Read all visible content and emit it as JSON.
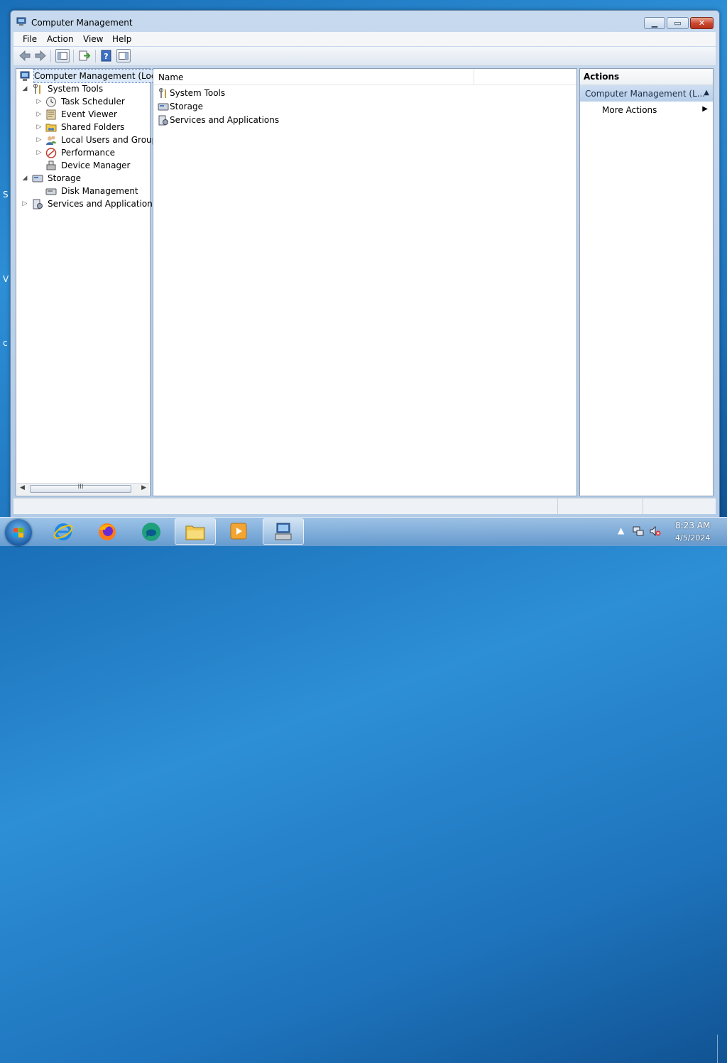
{
  "window": {
    "title": "Computer Management",
    "min_glyph": "▁",
    "max_glyph": "▭",
    "close_glyph": "✕"
  },
  "desktop_glyphs": [
    "S",
    "V",
    "c"
  ],
  "menu": [
    "File",
    "Action",
    "View",
    "Help"
  ],
  "tree": {
    "root": "Computer Management (Local",
    "items": [
      {
        "label": "System Tools",
        "expander": "◢",
        "icon": "tools-icon"
      },
      {
        "label": "Task Scheduler",
        "expander": "▷",
        "icon": "clock-icon"
      },
      {
        "label": "Event Viewer",
        "expander": "▷",
        "icon": "event-viewer-icon"
      },
      {
        "label": "Shared Folders",
        "expander": "▷",
        "icon": "shared-folder-icon"
      },
      {
        "label": "Local Users and Groups",
        "expander": "▷",
        "icon": "users-icon"
      },
      {
        "label": "Performance",
        "expander": "▷",
        "icon": "performance-icon"
      },
      {
        "label": "Device Manager",
        "expander": "",
        "icon": "device-manager-icon"
      },
      {
        "label": "Storage",
        "expander": "◢",
        "icon": "storage-icon"
      },
      {
        "label": "Disk Management",
        "expander": "",
        "icon": "disk-icon"
      },
      {
        "label": "Services and Applications",
        "expander": "▷",
        "icon": "services-icon"
      }
    ],
    "scroll_grip": "III",
    "scroll_left": "◀",
    "scroll_right": "▶"
  },
  "content": {
    "column_name": "Name",
    "items": [
      "System Tools",
      "Storage",
      "Services and Applications"
    ]
  },
  "actions": {
    "header": "Actions",
    "section": "Computer Management (L...",
    "section_arrow": "▲",
    "items": [
      {
        "label": "More Actions",
        "arrow": "▶"
      }
    ]
  },
  "taskbar": {
    "time": "8:23 AM",
    "date": "4/5/2024",
    "tray_up": "▲"
  },
  "colors": {
    "selection": "#dbe8f8",
    "actions_section": "#c4d7ee",
    "close_button": "#c9452c"
  }
}
